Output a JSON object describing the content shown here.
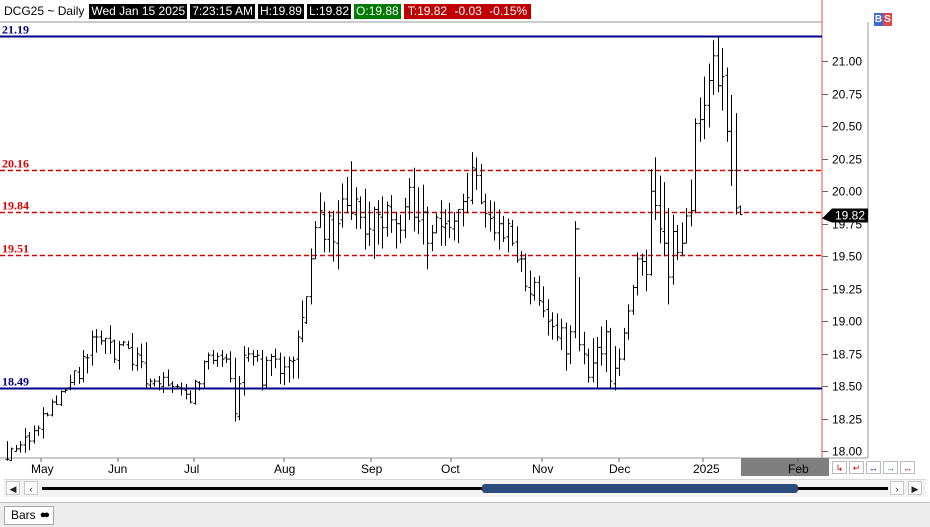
{
  "header": {
    "symbol": "DCG25 ~ Daily",
    "date": "Wed Jan 15 2025",
    "time": "7:23:15 AM",
    "high": "H:19.89",
    "low": "L:19.82",
    "open": "O:19.88",
    "last": "T:19.82",
    "change": "-0.03",
    "pct": "-0.15%"
  },
  "bs": {
    "b": "B",
    "s": "S"
  },
  "tab": {
    "label": "Bars"
  },
  "colors": {
    "support": "#00008b",
    "level": "#e00000",
    "bars": "#000000",
    "grid": "#e0e0e0"
  },
  "chart_data": {
    "type": "bar",
    "ylim": [
      17.95,
      21.3
    ],
    "yticks": [
      "18.00",
      "18.25",
      "18.50",
      "18.75",
      "19.00",
      "19.25",
      "19.50",
      "19.75",
      "20.00",
      "20.25",
      "20.50",
      "20.75",
      "21.00"
    ],
    "xticks": [
      "May",
      "Jun",
      "Jul",
      "Aug",
      "Sep",
      "Oct",
      "Nov",
      "Dec",
      "2025",
      "Feb"
    ],
    "last_price": "19.82",
    "hlines": [
      {
        "label": "21.19",
        "value": 21.19,
        "style": "solid",
        "color": "#00008b"
      },
      {
        "label": "20.16",
        "value": 20.16,
        "style": "dashed",
        "color": "#e00000"
      },
      {
        "label": "19.84",
        "value": 19.84,
        "style": "dashed",
        "color": "#e00000"
      },
      {
        "label": "19.51",
        "value": 19.51,
        "style": "dashed",
        "color": "#e00000"
      },
      {
        "label": "18.49",
        "value": 18.49,
        "style": "solid",
        "color": "#00008b"
      }
    ],
    "bars": [
      [
        17.94,
        18.08,
        17.93,
        17.94
      ],
      [
        17.93,
        18.03,
        17.93,
        18.02
      ],
      [
        18.0,
        18.05,
        18.0,
        18.02
      ],
      [
        18.02,
        18.08,
        17.99,
        18.05
      ],
      [
        18.05,
        18.18,
        17.99,
        18.11
      ],
      [
        18.12,
        18.15,
        18.01,
        18.08
      ],
      [
        18.08,
        18.2,
        18.06,
        18.16
      ],
      [
        18.16,
        18.2,
        18.12,
        18.18
      ],
      [
        18.17,
        18.34,
        18.1,
        18.29
      ],
      [
        18.29,
        18.3,
        18.27,
        18.28
      ],
      [
        18.28,
        18.4,
        18.27,
        18.38
      ],
      [
        18.38,
        18.43,
        18.36,
        18.36
      ],
      [
        18.36,
        18.47,
        18.35,
        18.46
      ],
      [
        18.46,
        18.49,
        18.45,
        18.47
      ],
      [
        18.49,
        18.59,
        18.47,
        18.53
      ],
      [
        18.53,
        18.62,
        18.51,
        18.62
      ],
      [
        18.61,
        18.65,
        18.52,
        18.56
      ],
      [
        18.56,
        18.78,
        18.53,
        18.73
      ],
      [
        18.72,
        18.75,
        18.6,
        18.72
      ],
      [
        18.74,
        18.93,
        18.66,
        18.88
      ],
      [
        18.88,
        18.94,
        18.76,
        18.88
      ],
      [
        18.88,
        18.93,
        18.82,
        18.85
      ],
      [
        18.85,
        18.87,
        18.75,
        18.87
      ],
      [
        18.87,
        18.97,
        18.75,
        18.84
      ],
      [
        18.85,
        18.86,
        18.68,
        18.71
      ],
      [
        18.7,
        18.85,
        18.63,
        18.82
      ],
      [
        18.82,
        18.85,
        18.81,
        18.84
      ],
      [
        18.82,
        18.85,
        18.79,
        18.79
      ],
      [
        18.8,
        18.91,
        18.62,
        18.67
      ],
      [
        18.66,
        18.8,
        18.62,
        18.75
      ],
      [
        18.74,
        18.83,
        18.64,
        18.69
      ],
      [
        18.68,
        18.84,
        18.49,
        18.52
      ],
      [
        18.51,
        18.56,
        18.49,
        18.54
      ],
      [
        18.52,
        18.56,
        18.5,
        18.54
      ],
      [
        18.54,
        18.58,
        18.47,
        18.52
      ],
      [
        18.5,
        18.61,
        18.45,
        18.57
      ],
      [
        18.57,
        18.63,
        18.5,
        18.51
      ],
      [
        18.52,
        18.54,
        18.45,
        18.5
      ],
      [
        18.5,
        18.52,
        18.48,
        18.5
      ],
      [
        18.49,
        18.53,
        18.43,
        18.48
      ],
      [
        18.47,
        18.52,
        18.4,
        18.44
      ],
      [
        18.44,
        18.47,
        18.37,
        18.38
      ],
      [
        18.37,
        18.55,
        18.36,
        18.54
      ],
      [
        18.53,
        18.54,
        18.47,
        18.52
      ],
      [
        18.52,
        18.7,
        18.49,
        18.69
      ],
      [
        18.69,
        18.76,
        18.63,
        18.74
      ],
      [
        18.74,
        18.78,
        18.67,
        18.7
      ],
      [
        18.7,
        18.76,
        18.65,
        18.73
      ],
      [
        18.74,
        18.78,
        18.65,
        18.71
      ],
      [
        18.72,
        18.75,
        18.68,
        18.71
      ],
      [
        18.71,
        18.77,
        18.53,
        18.56
      ],
      [
        18.56,
        18.72,
        18.23,
        18.29
      ],
      [
        18.27,
        18.58,
        18.24,
        18.52
      ],
      [
        18.53,
        18.81,
        18.43,
        18.74
      ],
      [
        18.72,
        18.8,
        18.69,
        18.75
      ],
      [
        18.75,
        18.78,
        18.66,
        18.73
      ],
      [
        18.73,
        18.78,
        18.69,
        18.74
      ],
      [
        18.71,
        18.78,
        18.47,
        18.51
      ],
      [
        18.51,
        18.73,
        18.49,
        18.7
      ],
      [
        18.7,
        18.75,
        18.58,
        18.73
      ],
      [
        18.73,
        18.79,
        18.64,
        18.71
      ],
      [
        18.71,
        18.76,
        18.52,
        18.6
      ],
      [
        18.6,
        18.73,
        18.51,
        18.65
      ],
      [
        18.65,
        18.73,
        18.53,
        18.7
      ],
      [
        18.69,
        18.73,
        18.56,
        18.7
      ],
      [
        18.71,
        18.93,
        18.56,
        18.88
      ],
      [
        18.87,
        19.16,
        18.84,
        19.03
      ],
      [
        18.99,
        19.19,
        18.98,
        19.19
      ],
      [
        19.19,
        19.56,
        19.13,
        19.48
      ],
      [
        19.48,
        19.77,
        19.48,
        19.72
      ],
      [
        19.72,
        19.99,
        19.72,
        19.85
      ],
      [
        19.82,
        19.92,
        19.53,
        19.63
      ],
      [
        19.63,
        19.85,
        19.53,
        19.81
      ],
      [
        19.78,
        19.85,
        19.46,
        19.61
      ],
      [
        19.6,
        19.93,
        19.4,
        19.75
      ],
      [
        19.78,
        20.06,
        19.72,
        19.94
      ],
      [
        19.94,
        20.11,
        19.83,
        19.89
      ],
      [
        19.89,
        20.23,
        19.78,
        19.83
      ],
      [
        19.82,
        20.03,
        19.71,
        19.94
      ],
      [
        19.92,
        19.96,
        19.71,
        19.8
      ],
      [
        19.8,
        20.02,
        19.55,
        19.67
      ],
      [
        19.67,
        19.92,
        19.58,
        19.71
      ],
      [
        19.7,
        19.88,
        19.48,
        19.86
      ],
      [
        19.86,
        19.93,
        19.59,
        19.82
      ],
      [
        19.8,
        19.96,
        19.56,
        19.72
      ],
      [
        19.72,
        19.92,
        19.65,
        19.89
      ],
      [
        19.88,
        19.97,
        19.68,
        19.78
      ],
      [
        19.78,
        19.84,
        19.56,
        19.75
      ],
      [
        19.75,
        19.82,
        19.6,
        19.7
      ],
      [
        19.7,
        19.95,
        19.64,
        19.88
      ],
      [
        19.88,
        20.1,
        19.78,
        20.03
      ],
      [
        20.03,
        20.18,
        19.69,
        19.8
      ],
      [
        19.8,
        20.03,
        19.67,
        19.77
      ],
      [
        19.78,
        20.05,
        19.59,
        19.84
      ],
      [
        19.84,
        19.88,
        19.4,
        19.6
      ],
      [
        19.6,
        19.74,
        19.54,
        19.68
      ],
      [
        19.68,
        19.83,
        19.68,
        19.8
      ],
      [
        19.79,
        19.93,
        19.58,
        19.73
      ],
      [
        19.72,
        19.86,
        19.58,
        19.75
      ],
      [
        19.77,
        19.91,
        19.64,
        19.72
      ],
      [
        19.71,
        19.84,
        19.62,
        19.77
      ],
      [
        19.77,
        19.86,
        19.6,
        19.86
      ],
      [
        19.86,
        19.98,
        19.73,
        19.92
      ],
      [
        19.92,
        20.14,
        19.83,
        19.95
      ],
      [
        19.93,
        20.3,
        19.9,
        20.18
      ],
      [
        20.17,
        20.26,
        20.01,
        20.12
      ],
      [
        20.12,
        20.21,
        19.9,
        19.91
      ],
      [
        19.92,
        19.98,
        19.72,
        19.83
      ],
      [
        19.82,
        19.93,
        19.69,
        19.79
      ],
      [
        19.8,
        19.92,
        19.62,
        19.68
      ],
      [
        19.68,
        19.86,
        19.55,
        19.75
      ],
      [
        19.75,
        19.81,
        19.61,
        19.64
      ],
      [
        19.65,
        19.79,
        19.53,
        19.75
      ],
      [
        19.73,
        19.78,
        19.58,
        19.6
      ],
      [
        19.61,
        19.73,
        19.45,
        19.47
      ],
      [
        19.48,
        19.54,
        19.38,
        19.48
      ],
      [
        19.48,
        19.52,
        19.23,
        19.27
      ],
      [
        19.26,
        19.39,
        19.13,
        19.21
      ],
      [
        19.2,
        19.34,
        19.16,
        19.3
      ],
      [
        19.3,
        19.35,
        19.12,
        19.16
      ],
      [
        19.15,
        19.27,
        19.03,
        19.08
      ],
      [
        19.09,
        19.17,
        18.89,
        19.0
      ],
      [
        19.01,
        19.07,
        18.86,
        18.96
      ],
      [
        18.97,
        19.06,
        18.85,
        18.88
      ],
      [
        18.87,
        19.02,
        18.78,
        18.95
      ],
      [
        18.95,
        18.99,
        18.62,
        18.75
      ],
      [
        18.75,
        18.97,
        18.67,
        18.92
      ],
      [
        18.92,
        19.77,
        18.87,
        19.71
      ],
      [
        19.71,
        19.34,
        18.77,
        18.82
      ],
      [
        18.82,
        18.92,
        18.67,
        18.75
      ],
      [
        18.74,
        18.79,
        18.53,
        18.57
      ],
      [
        18.57,
        18.87,
        18.53,
        18.68
      ],
      [
        18.68,
        18.88,
        18.49,
        18.8
      ],
      [
        18.8,
        18.96,
        18.66,
        18.75
      ],
      [
        18.75,
        19.01,
        18.61,
        18.92
      ],
      [
        18.92,
        18.95,
        18.49,
        18.54
      ],
      [
        18.52,
        18.81,
        18.47,
        18.64
      ],
      [
        18.64,
        18.79,
        18.58,
        18.71
      ],
      [
        18.71,
        18.95,
        18.7,
        18.91
      ],
      [
        18.91,
        19.13,
        18.86,
        19.08
      ],
      [
        19.08,
        19.28,
        19.05,
        19.26
      ],
      [
        19.26,
        19.53,
        19.2,
        19.48
      ],
      [
        19.48,
        19.52,
        19.35,
        19.46
      ],
      [
        19.46,
        19.55,
        19.23,
        19.36
      ],
      [
        19.36,
        20.17,
        19.35,
        20.0
      ],
      [
        20.0,
        20.26,
        19.78,
        19.89
      ],
      [
        19.89,
        20.12,
        19.6,
        19.71
      ],
      [
        19.69,
        20.07,
        19.5,
        19.6
      ],
      [
        19.6,
        19.87,
        19.13,
        19.34
      ],
      [
        19.34,
        19.82,
        19.28,
        19.69
      ],
      [
        19.69,
        19.74,
        19.47,
        19.53
      ],
      [
        19.53,
        19.76,
        19.5,
        19.6
      ],
      [
        19.6,
        19.87,
        19.6,
        19.81
      ],
      [
        19.81,
        20.09,
        19.73,
        19.85
      ],
      [
        19.85,
        20.56,
        19.83,
        20.52
      ],
      [
        20.52,
        20.72,
        20.38,
        20.55
      ],
      [
        20.55,
        20.88,
        20.4,
        20.66
      ],
      [
        20.66,
        20.98,
        20.49,
        20.85
      ],
      [
        20.85,
        21.16,
        20.74,
        21.04
      ],
      [
        21.04,
        21.19,
        20.76,
        20.81
      ],
      [
        20.81,
        21.1,
        20.62,
        20.88
      ],
      [
        20.89,
        20.95,
        20.38,
        20.46
      ],
      [
        20.46,
        20.74,
        20.04,
        20.16
      ],
      [
        20.16,
        20.6,
        19.82,
        19.87
      ],
      [
        19.88,
        19.89,
        19.82,
        19.82
      ]
    ]
  }
}
